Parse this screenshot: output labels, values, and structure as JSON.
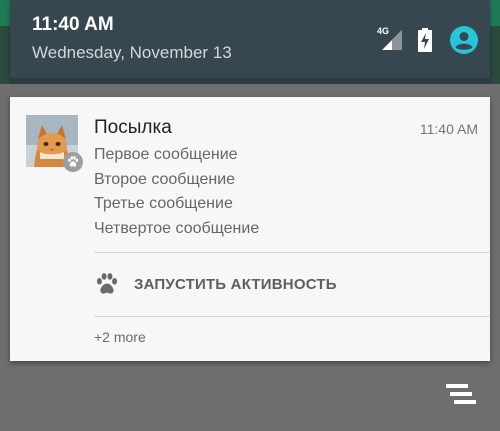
{
  "status": {
    "time": "11:40 AM",
    "date": "Wednesday, November 13",
    "network_label": "4G",
    "icons": [
      "signal-icon",
      "battery-charging-icon",
      "user-avatar-icon"
    ],
    "accent": "#26c6da"
  },
  "notification": {
    "title": "Посылка",
    "time": "11:40 AM",
    "messages": [
      "Первое сообщение",
      "Второе сообщение",
      "Третье сообщение",
      "Четвертое сообщение"
    ],
    "action_label": "ЗАПУСТИТЬ АКТИВНОСТЬ",
    "action_icon": "paw-icon",
    "more_label": "+2 more",
    "image": "cat-photo"
  },
  "footer": {
    "clear_icon": "clear-all-icon"
  }
}
